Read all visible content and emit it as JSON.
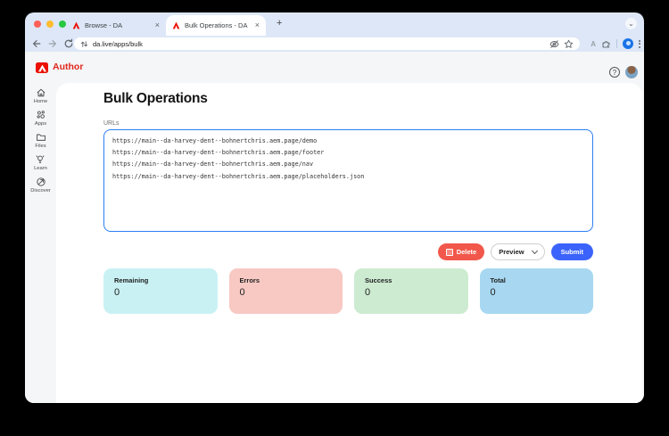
{
  "colors": {
    "chrome_bg": "#dde7f7",
    "app_bg": "#f5f6f7",
    "brand_red": "#eb1000",
    "author_red": "#e1261c",
    "delete_red": "#f2574b",
    "submit_blue": "#3b63fb",
    "textarea_border": "#2b7ff2",
    "traffic_close": "#ff5f57",
    "traffic_min": "#febc2e",
    "traffic_zoom": "#28c840"
  },
  "browser": {
    "tabs": [
      {
        "title": "Browse - DA"
      },
      {
        "title": "Bulk Operations - DA"
      }
    ],
    "icons": {
      "close": "×",
      "plus": "+",
      "help": "?",
      "chevron": "⌄"
    },
    "address": {
      "url": "da.live/apps/bulk"
    },
    "extension_badge": "A"
  },
  "app": {
    "brand": "Author",
    "sidebar": [
      {
        "label": "Home"
      },
      {
        "label": "Apps"
      },
      {
        "label": "Files"
      },
      {
        "label": "Learn"
      },
      {
        "label": "Discover"
      }
    ],
    "main": {
      "title": "Bulk Operations",
      "urls_label": "URLs",
      "urls_value": "https://main--da-harvey-dent--bohnertchris.aem.page/demo\nhttps://main--da-harvey-dent--bohnertchris.aem.page/footer\nhttps://main--da-harvey-dent--bohnertchris.aem.page/nav\nhttps://main--da-harvey-dent--bohnertchris.aem.page/placeholders.json",
      "actions": {
        "delete": "Delete",
        "operation": "Preview",
        "submit": "Submit"
      },
      "stats": [
        {
          "label": "Remaining",
          "value": "0",
          "bg": "#c9f1f4"
        },
        {
          "label": "Errors",
          "value": "0",
          "bg": "#f8c9c3"
        },
        {
          "label": "Success",
          "value": "0",
          "bg": "#cdebd1"
        },
        {
          "label": "Total",
          "value": "0",
          "bg": "#a8d8f1"
        }
      ]
    }
  }
}
